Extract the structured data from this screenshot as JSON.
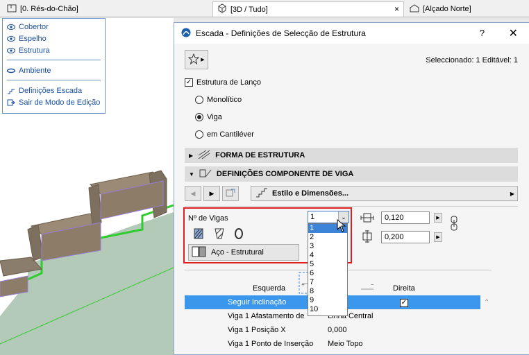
{
  "tabs": [
    {
      "label": "[0. Rés-do-Chão]",
      "icon": "floor-plan-icon"
    },
    {
      "label": "[3D / Tudo]",
      "icon": "3d-cube-icon",
      "close": "×"
    },
    {
      "label": "[Alçado Norte]",
      "icon": "elevation-icon"
    }
  ],
  "palette": {
    "items_top": [
      "Cobertor",
      "Espelho",
      "Estrutura"
    ],
    "item_mid": "Ambiente",
    "items_bottom": [
      "Definições Escada",
      "Sair de Modo de Edição"
    ]
  },
  "dialog": {
    "title": "Escada - Definições de Selecção de Estrutura",
    "help": "?",
    "close": "✕",
    "selected_info": "Seleccionado: 1 Editável: 1",
    "structure_check": {
      "label": "Estrutura de Lanço",
      "checked": true
    },
    "radios": [
      {
        "label": "Monolítico",
        "selected": false
      },
      {
        "label": "Viga",
        "selected": true
      },
      {
        "label": "em Cantiléver",
        "selected": false
      }
    ],
    "sections": {
      "shape": "FORMA DE ESTRUTURA",
      "beam": "DEFINIÇÕES COMPONENTE DE VIGA"
    },
    "style_button": "Estilo e Dimensões...",
    "beam_count": {
      "label": "Nº de Vigas",
      "value": "1",
      "options": [
        "1",
        "2",
        "3",
        "4",
        "5",
        "6",
        "7",
        "8",
        "9",
        "10"
      ]
    },
    "width_value": "0,120",
    "height_value": "0,200",
    "material": "Aço - Estrutural",
    "columns": {
      "left": "Esquerda",
      "right": "Direita"
    },
    "properties": [
      {
        "key": "Seguir Inclinação",
        "value": "",
        "checked": true
      },
      {
        "key": "Viga 1 Afastamento de",
        "value": "Linha Central"
      },
      {
        "key": "Viga 1 Posição X",
        "value": "0,000"
      },
      {
        "key": "Viga 1 Ponto de Inserção",
        "value": "Meio Topo"
      }
    ]
  },
  "colors": {
    "highlight": "#3b97eb",
    "annotation_red": "#e02020",
    "link_blue": "#1a4fa0",
    "edit_green": "#2ecc2e"
  }
}
